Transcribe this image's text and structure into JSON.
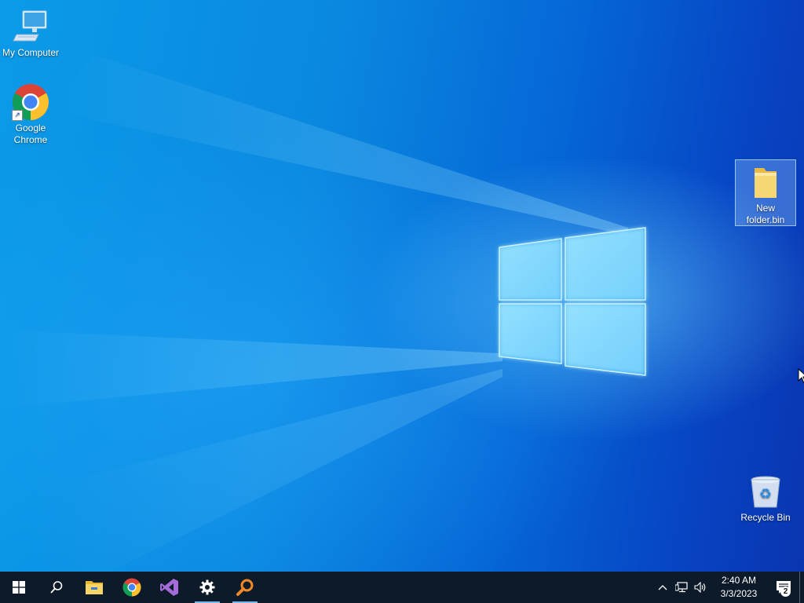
{
  "desktop": {
    "icons": [
      {
        "label": "My Computer"
      },
      {
        "label": "Google Chrome"
      },
      {
        "label": "New folder.bin"
      },
      {
        "label": "Recycle Bin"
      }
    ]
  },
  "taskbar": {
    "items": [
      {
        "name": "start",
        "icon": "windows-icon"
      },
      {
        "name": "search",
        "icon": "search-icon"
      },
      {
        "name": "file-explorer",
        "icon": "folder-icon"
      },
      {
        "name": "chrome",
        "icon": "chrome-icon"
      },
      {
        "name": "visual-studio",
        "icon": "visual-studio-icon"
      },
      {
        "name": "settings",
        "icon": "gear-icon",
        "active": true
      },
      {
        "name": "search-app",
        "icon": "magnifier-orange-icon",
        "active": true
      }
    ],
    "clock": {
      "time": "2:40 AM",
      "date": "3/3/2023"
    },
    "notifications": {
      "count": "2"
    }
  },
  "colors": {
    "accent": "#76b9ed",
    "taskbar": "#0d1a2a"
  }
}
